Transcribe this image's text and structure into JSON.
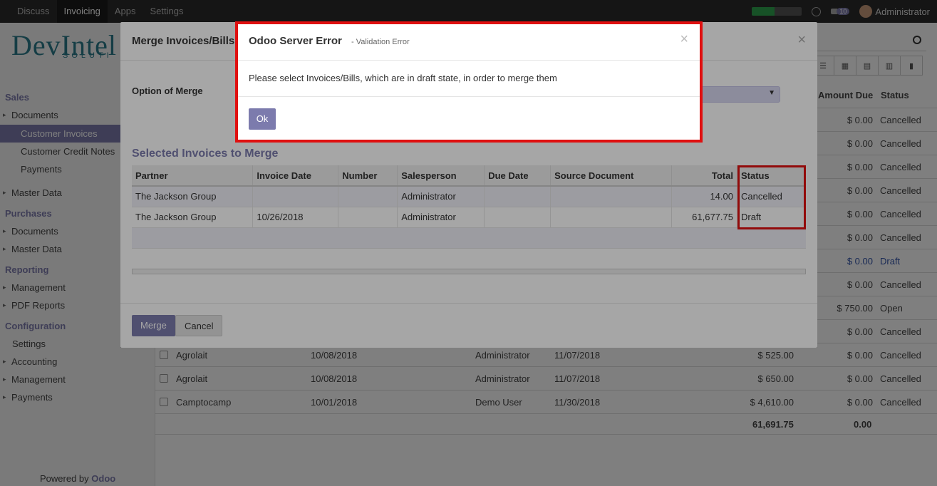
{
  "topbar": {
    "menus": [
      "Discuss",
      "Invoicing",
      "Apps",
      "Settings"
    ],
    "active_menu": "Invoicing",
    "chat_count": "10",
    "user": "Administrator",
    "activity_progress": 0.45
  },
  "sidebar": {
    "logo_text": "DevIntel",
    "logo_sub": "SOLUTI",
    "sections": [
      {
        "title": "Sales",
        "items": [
          "Documents",
          "Customer Invoices",
          "Customer Credit Notes",
          "Payments",
          "Master Data"
        ]
      },
      {
        "title": "Purchases",
        "items": [
          "Documents",
          "Master Data"
        ]
      },
      {
        "title": "Reporting",
        "items": [
          "Management",
          "PDF Reports"
        ]
      },
      {
        "title": "Configuration",
        "items": [
          "Settings",
          "Accounting",
          "Management",
          "Payments"
        ]
      }
    ],
    "powered_by": "Powered by",
    "powered_brand": "Odoo"
  },
  "background_list": {
    "headers": {
      "amount_due": "Amount Due",
      "status": "Status"
    },
    "rows": [
      {
        "partner": "",
        "date": "",
        "salesperson": "",
        "due": "",
        "total": "",
        "amount_due": "$ 0.00",
        "status": "Cancelled"
      },
      {
        "partner": "",
        "date": "",
        "salesperson": "",
        "due": "",
        "total": "",
        "amount_due": "$ 0.00",
        "status": "Cancelled"
      },
      {
        "partner": "",
        "date": "",
        "salesperson": "",
        "due": "",
        "total": "",
        "amount_due": "$ 0.00",
        "status": "Cancelled"
      },
      {
        "partner": "",
        "date": "",
        "salesperson": "",
        "due": "",
        "total": "",
        "amount_due": "$ 0.00",
        "status": "Cancelled"
      },
      {
        "partner": "",
        "date": "",
        "salesperson": "",
        "due": "",
        "total": "",
        "amount_due": "$ 0.00",
        "status": "Cancelled"
      },
      {
        "partner": "",
        "date": "",
        "salesperson": "",
        "due": "",
        "total": "",
        "amount_due": "$ 0.00",
        "status": "Cancelled"
      },
      {
        "partner": "",
        "date": "",
        "salesperson": "",
        "due": "",
        "total": "",
        "amount_due": "$ 0.00",
        "status": "Draft"
      },
      {
        "partner": "",
        "date": "",
        "salesperson": "",
        "due": "",
        "total": "",
        "amount_due": "$ 0.00",
        "status": "Cancelled"
      },
      {
        "partner": "",
        "date": "",
        "salesperson": "",
        "due": "",
        "total": "",
        "amount_due": "$ 750.00",
        "status": "Open"
      },
      {
        "partner": "",
        "date": "",
        "salesperson": "",
        "due": "",
        "total": "",
        "amount_due": "$ 0.00",
        "status": "Cancelled"
      },
      {
        "partner": "Agrolait",
        "date": "10/08/2018",
        "salesperson": "Administrator",
        "due": "11/07/2018",
        "total": "$ 525.00",
        "amount_due": "$ 0.00",
        "status": "Cancelled"
      },
      {
        "partner": "Agrolait",
        "date": "10/08/2018",
        "salesperson": "Administrator",
        "due": "11/07/2018",
        "total": "$ 650.00",
        "amount_due": "$ 0.00",
        "status": "Cancelled"
      },
      {
        "partner": "Camptocamp",
        "date": "10/01/2018",
        "salesperson": "Demo User",
        "due": "11/30/2018",
        "total": "$ 4,610.00",
        "amount_due": "$ 0.00",
        "status": "Cancelled"
      }
    ],
    "footer_total": "61,691.75",
    "footer_due": "0.00"
  },
  "merge_dialog": {
    "title": "Merge Invoices/Bills",
    "close": "×",
    "option_label": "Option of Merge",
    "selected_title": "Selected Invoices to Merge",
    "columns": [
      "Partner",
      "Invoice Date",
      "Number",
      "Salesperson",
      "Due Date",
      "Source Document",
      "Total",
      "Status"
    ],
    "rows": [
      {
        "partner": "The Jackson Group",
        "invoice_date": "",
        "number": "",
        "salesperson": "Administrator",
        "due_date": "",
        "source": "",
        "total": "14.00",
        "status": "Cancelled"
      },
      {
        "partner": "The Jackson Group",
        "invoice_date": "10/26/2018",
        "number": "",
        "salesperson": "Administrator",
        "due_date": "",
        "source": "",
        "total": "61,677.75",
        "status": "Draft"
      }
    ],
    "merge_label": "Merge",
    "cancel_label": "Cancel"
  },
  "error_dialog": {
    "title": "Odoo Server Error",
    "subtitle": "- Validation Error",
    "close": "×",
    "message": "Please select Invoices/Bills, which are in draft state, in order to merge them",
    "ok_label": "Ok"
  },
  "colors": {
    "accent": "#7c7bad",
    "highlight": "#e01010"
  }
}
